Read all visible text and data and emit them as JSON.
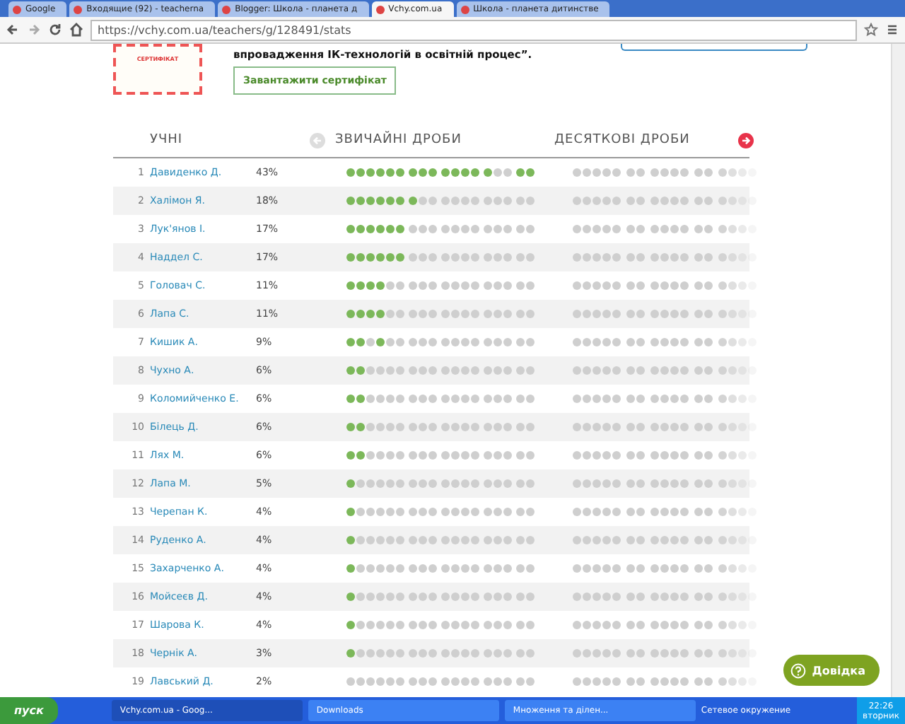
{
  "browser": {
    "tabs": [
      {
        "title": "Google",
        "selected": false
      },
      {
        "title": "Входящие (92) - teacherna",
        "selected": false
      },
      {
        "title": "Blogger: Школа - планета д",
        "selected": false
      },
      {
        "title": "Vchy.com.ua",
        "selected": true
      },
      {
        "title": "Школа - планета дитинстве",
        "selected": false
      }
    ],
    "address": "https://vchy.com.ua/teachers/g/128491/stats"
  },
  "certificate": {
    "image_title": "СЕРТИФІКАТ",
    "text_2": "впровадження ІК-технологій в освітній процес”.",
    "download_button": "Завантажити сертифікат"
  },
  "table": {
    "columns": [
      "УЧНІ",
      "ЗВИЧАЙНІ ДРОБИ",
      "ДЕСЯТКОВІ ДРОБИ"
    ],
    "rows": [
      {
        "n": "1",
        "name": "Давиденко Д.",
        "pct": "43%",
        "dots": [
          [
            true,
            true,
            true,
            true,
            true,
            true
          ],
          [
            true,
            true,
            true
          ],
          [
            true,
            true,
            true,
            true
          ],
          [
            true,
            false,
            false
          ],
          [
            true,
            true
          ]
        ]
      },
      {
        "n": "2",
        "name": "Халімон Я.",
        "pct": "18%",
        "dots": [
          [
            true,
            true,
            true,
            true,
            true,
            true
          ],
          [
            true,
            false,
            false
          ],
          [
            false,
            false,
            false,
            false
          ],
          [
            false,
            false,
            false
          ],
          [
            false,
            false
          ]
        ]
      },
      {
        "n": "3",
        "name": "Лук'янов І.",
        "pct": "17%",
        "dots": [
          [
            true,
            true,
            true,
            true,
            true,
            true
          ],
          [
            false,
            false,
            false
          ],
          [
            false,
            false,
            false,
            false
          ],
          [
            false,
            false,
            false
          ],
          [
            false,
            false
          ]
        ]
      },
      {
        "n": "4",
        "name": "Наддел С.",
        "pct": "17%",
        "dots": [
          [
            true,
            true,
            true,
            true,
            true,
            true
          ],
          [
            false,
            false,
            false
          ],
          [
            false,
            false,
            false,
            false
          ],
          [
            false,
            false,
            false
          ],
          [
            false,
            false
          ]
        ]
      },
      {
        "n": "5",
        "name": "Головач С.",
        "pct": "11%",
        "dots": [
          [
            true,
            true,
            true,
            true,
            false,
            false
          ],
          [
            false,
            false,
            false
          ],
          [
            false,
            false,
            false,
            false
          ],
          [
            false,
            false,
            false
          ],
          [
            false,
            false
          ]
        ]
      },
      {
        "n": "6",
        "name": "Лапа С.",
        "pct": "11%",
        "dots": [
          [
            true,
            true,
            true,
            true,
            false,
            false
          ],
          [
            false,
            false,
            false
          ],
          [
            false,
            false,
            false,
            false
          ],
          [
            false,
            false,
            false
          ],
          [
            false,
            false
          ]
        ]
      },
      {
        "n": "7",
        "name": "Кишик А.",
        "pct": "9%",
        "dots": [
          [
            true,
            true,
            false,
            true,
            false,
            false
          ],
          [
            false,
            false,
            false
          ],
          [
            false,
            false,
            false,
            false
          ],
          [
            false,
            false,
            false
          ],
          [
            false,
            false
          ]
        ]
      },
      {
        "n": "8",
        "name": "Чухно А.",
        "pct": "6%",
        "dots": [
          [
            true,
            true,
            false,
            false,
            false,
            false
          ],
          [
            false,
            false,
            false
          ],
          [
            false,
            false,
            false,
            false
          ],
          [
            false,
            false,
            false
          ],
          [
            false,
            false
          ]
        ]
      },
      {
        "n": "9",
        "name": "Коломийченко Е.",
        "pct": "6%",
        "dots": [
          [
            true,
            true,
            false,
            false,
            false,
            false
          ],
          [
            false,
            false,
            false
          ],
          [
            false,
            false,
            false,
            false
          ],
          [
            false,
            false,
            false
          ],
          [
            false,
            false
          ]
        ]
      },
      {
        "n": "10",
        "name": "Білець Д.",
        "pct": "6%",
        "dots": [
          [
            true,
            true,
            false,
            false,
            false,
            false
          ],
          [
            false,
            false,
            false
          ],
          [
            false,
            false,
            false,
            false
          ],
          [
            false,
            false,
            false
          ],
          [
            false,
            false
          ]
        ]
      },
      {
        "n": "11",
        "name": "Лях М.",
        "pct": "6%",
        "dots": [
          [
            true,
            true,
            false,
            false,
            false,
            false
          ],
          [
            false,
            false,
            false
          ],
          [
            false,
            false,
            false,
            false
          ],
          [
            false,
            false,
            false
          ],
          [
            false,
            false
          ]
        ]
      },
      {
        "n": "12",
        "name": "Лапа М.",
        "pct": "5%",
        "dots": [
          [
            true,
            false,
            false,
            false,
            false,
            false
          ],
          [
            false,
            false,
            false
          ],
          [
            false,
            false,
            false,
            false
          ],
          [
            false,
            false,
            false
          ],
          [
            false,
            false
          ]
        ]
      },
      {
        "n": "13",
        "name": "Черепан К.",
        "pct": "4%",
        "dots": [
          [
            true,
            false,
            false,
            false,
            false,
            false
          ],
          [
            false,
            false,
            false
          ],
          [
            false,
            false,
            false,
            false
          ],
          [
            false,
            false,
            false
          ],
          [
            false,
            false
          ]
        ]
      },
      {
        "n": "14",
        "name": "Руденко А.",
        "pct": "4%",
        "dots": [
          [
            true,
            false,
            false,
            false,
            false,
            false
          ],
          [
            false,
            false,
            false
          ],
          [
            false,
            false,
            false,
            false
          ],
          [
            false,
            false,
            false
          ],
          [
            false,
            false
          ]
        ]
      },
      {
        "n": "15",
        "name": "Захарченко А.",
        "pct": "4%",
        "dots": [
          [
            true,
            false,
            false,
            false,
            false,
            false
          ],
          [
            false,
            false,
            false
          ],
          [
            false,
            false,
            false,
            false
          ],
          [
            false,
            false,
            false
          ],
          [
            false,
            false
          ]
        ]
      },
      {
        "n": "16",
        "name": "Мойсеєв Д.",
        "pct": "4%",
        "dots": [
          [
            true,
            false,
            false,
            false,
            false,
            false
          ],
          [
            false,
            false,
            false
          ],
          [
            false,
            false,
            false,
            false
          ],
          [
            false,
            false,
            false
          ],
          [
            false,
            false
          ]
        ]
      },
      {
        "n": "17",
        "name": "Шарова К.",
        "pct": "4%",
        "dots": [
          [
            true,
            false,
            false,
            false,
            false,
            false
          ],
          [
            false,
            false,
            false
          ],
          [
            false,
            false,
            false,
            false
          ],
          [
            false,
            false,
            false
          ],
          [
            false,
            false
          ]
        ]
      },
      {
        "n": "18",
        "name": "Чернік А.",
        "pct": "3%",
        "dots": [
          [
            true,
            false,
            false,
            false,
            false,
            false
          ],
          [
            false,
            false,
            false
          ],
          [
            false,
            false,
            false,
            false
          ],
          [
            false,
            false,
            false
          ],
          [
            false,
            false
          ]
        ]
      },
      {
        "n": "19",
        "name": "Лавський Д.",
        "pct": "2%",
        "dots": [
          [
            false,
            false,
            false,
            false,
            false,
            false
          ],
          [
            false,
            false,
            false
          ],
          [
            false,
            false,
            false,
            false
          ],
          [
            false,
            false,
            false
          ],
          [
            false,
            false
          ]
        ]
      }
    ]
  },
  "help_button": "Довідка",
  "taskbar": {
    "start": "пуск",
    "windows": [
      {
        "title": "Vchy.com.ua - Goog...",
        "selected": true
      },
      {
        "title": "Downloads",
        "selected": false
      },
      {
        "title": "Множення та ділен...",
        "selected": false
      }
    ],
    "network": "Сетевое окружение",
    "time": "22:26",
    "day": "вторник"
  }
}
